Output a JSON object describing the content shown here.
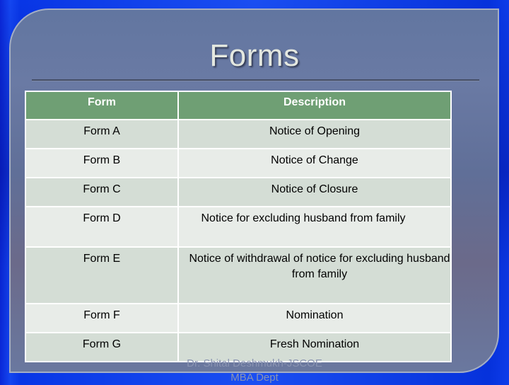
{
  "slide": {
    "title": "Forms",
    "table": {
      "headers": [
        "Form",
        "Description"
      ],
      "rows": [
        {
          "form": "Form A",
          "description": "Notice of Opening"
        },
        {
          "form": "Form B",
          "description": "Notice of Change"
        },
        {
          "form": "Form C",
          "description": "Notice of Closure"
        },
        {
          "form": "Form D",
          "description": "Notice for excluding husband from family"
        },
        {
          "form": "Form E",
          "description": "Notice of withdrawal of  notice for excluding husband from family"
        },
        {
          "form": "Form F",
          "description": "Nomination"
        },
        {
          "form": "Form G",
          "description": "Fresh Nomination"
        }
      ]
    },
    "footer": {
      "line1": "Dr. Shital Deshmukh-JSCOE",
      "line2": "MBA Dept"
    },
    "colors": {
      "header_bg": "#6f9f74",
      "row_odd_bg": "#d4ddd5",
      "row_even_bg": "#e8ece8",
      "panel_bg": "#6276a0",
      "background": "#1446f0"
    }
  }
}
